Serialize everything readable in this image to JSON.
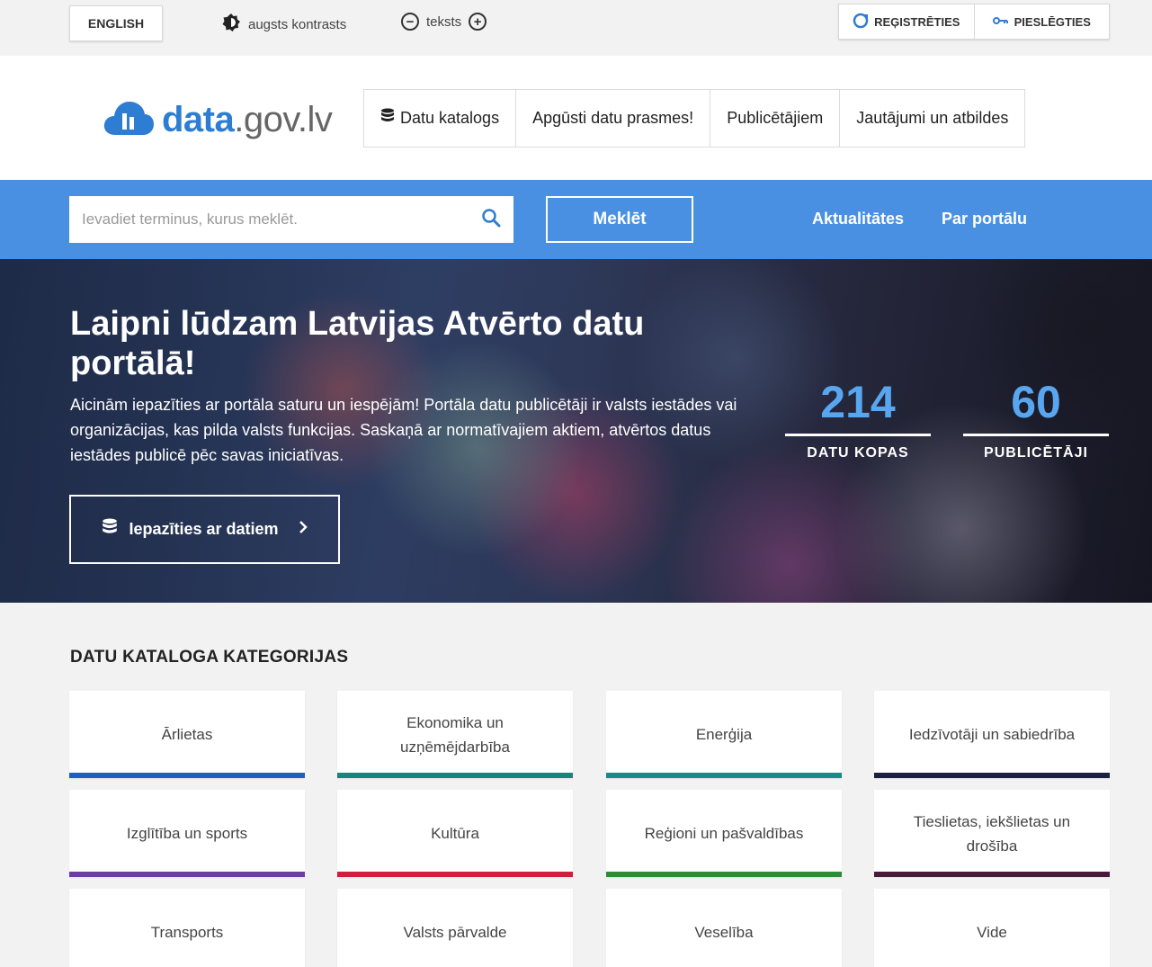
{
  "topbar": {
    "language_button": "ENGLISH",
    "contrast_label": "augsts kontrasts",
    "text_label": "teksts",
    "text_decrease": "−",
    "text_increase": "+",
    "register": "REĢISTRĒTIES",
    "login": "PIESLĒGTIES"
  },
  "header": {
    "logo_main": "data",
    "logo_domain": ".gov.lv",
    "nav": [
      "Datu katalogs",
      "Apgūsti datu prasmes!",
      "Publicētājiem",
      "Jautājumi un atbildes"
    ]
  },
  "search": {
    "placeholder": "Ievadiet terminus, kurus meklēt.",
    "button": "Meklēt",
    "links": [
      "Aktualitātes",
      "Par portālu"
    ]
  },
  "hero": {
    "title": "Laipni lūdzam Latvijas Atvērto datu portālā!",
    "text": "Aicinām iepazīties ar portāla saturu un iespējām! Portāla datu publicētāji ir valsts iestādes vai organizācijas, kas pilda valsts funkcijas. Saskaņā ar normatīvajiem aktiem, atvērtos datus iestādes publicē pēc savas iniciatīvas.",
    "button": "Iepazīties ar datiem",
    "stats": [
      {
        "number": "214",
        "label": "DATU KOPAS"
      },
      {
        "number": "60",
        "label": "PUBLICĒTĀJI"
      }
    ]
  },
  "categories": {
    "title": "DATU KATALOGA KATEGORIJAS",
    "items": [
      {
        "label": "Ārlietas",
        "color": "#1f5fbf"
      },
      {
        "label": "Ekonomika un uzņēmējdarbība",
        "color": "#17867a"
      },
      {
        "label": "Enerģija",
        "color": "#1b8a86"
      },
      {
        "label": "Iedzīvotāji un sabiedrība",
        "color": "#1c2140"
      },
      {
        "label": "Izglītība un sports",
        "color": "#6b3ea0"
      },
      {
        "label": "Kultūra",
        "color": "#d01f3c"
      },
      {
        "label": "Reģioni un pašvaldības",
        "color": "#2f8a3a"
      },
      {
        "label": "Tieslietas, iekšlietas un drošība",
        "color": "#4a1a3a"
      },
      {
        "label": "Transports",
        "color": "#cccccc"
      },
      {
        "label": "Valsts pārvalde",
        "color": "#cccccc"
      },
      {
        "label": "Veselība",
        "color": "#cccccc"
      },
      {
        "label": "Vide",
        "color": "#cccccc"
      }
    ]
  },
  "colors": {
    "brand_blue": "#4a90e2",
    "stat_blue": "#58a6f0"
  }
}
